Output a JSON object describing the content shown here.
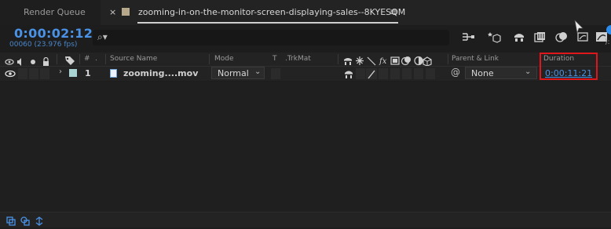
{
  "tabs": {
    "render_queue": "Render Queue",
    "active_close": "×",
    "active_name": "zooming-in-on-the-monitor-screen-displaying-sales--8KYESQM",
    "active_menu": "≡"
  },
  "time": {
    "timecode": "0:00:02:12",
    "frame_info": "00060 (23.976 fps)"
  },
  "search": {
    "placeholder": "",
    "icon_glyph": "⌕▾"
  },
  "columns": {
    "num": "#",
    "source_name": "Source Name",
    "mode": "Mode",
    "t": "T",
    "trkmat": ".TrkMat",
    "fx": "fx",
    "parent_link": "Parent & Link",
    "duration": "Duration"
  },
  "layer": {
    "number": "1",
    "name": "zooming....mov",
    "mode": "Normal",
    "parent": "None",
    "duration": "0:00:11:21",
    "label_color": "#a9d3d3"
  },
  "colors": {
    "accent": "#4a92e6",
    "highlight": "#e0161a"
  }
}
